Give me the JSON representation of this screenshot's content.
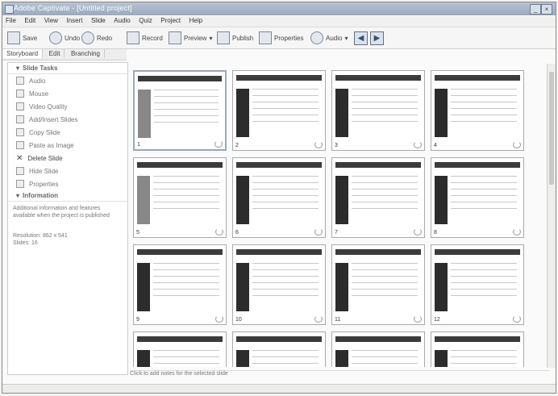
{
  "window": {
    "title": "Adobe Captivate - [Untitled project]"
  },
  "menu": [
    "File",
    "Edit",
    "View",
    "Insert",
    "Slide",
    "Audio",
    "Quiz",
    "Project",
    "Help"
  ],
  "toolbar": {
    "save": "Save",
    "undo": "Undo",
    "redo": "Redo",
    "record": "Record",
    "preview": "Preview",
    "publish": "Publish",
    "properties": "Properties",
    "audio": "Audio"
  },
  "view_tabs": [
    "Storyboard",
    "Edit",
    "Branching"
  ],
  "side_panel": {
    "slide_tasks_heading": "Slide Tasks",
    "tasks": [
      "Audio",
      "Mouse",
      "Video Quality",
      "Add/Insert Slides",
      "Copy Slide",
      "Paste as Image",
      "Delete Slide",
      "Hide Slide",
      "Properties"
    ],
    "information_heading": "Information",
    "information_text": "Additional information and features available when the project is published",
    "resolution": "Resolution: 862 x 541",
    "slides": "Slides: 16"
  },
  "slides": [
    {
      "num": "1"
    },
    {
      "num": "2"
    },
    {
      "num": "3"
    },
    {
      "num": "4"
    },
    {
      "num": "5"
    },
    {
      "num": "6"
    },
    {
      "num": "7"
    },
    {
      "num": "8"
    },
    {
      "num": "9"
    },
    {
      "num": "10"
    },
    {
      "num": "11"
    },
    {
      "num": "12"
    },
    {
      "num": ""
    },
    {
      "num": ""
    },
    {
      "num": ""
    },
    {
      "num": ""
    }
  ],
  "notes": {
    "placeholder": "Click to add notes for the selected slide"
  }
}
